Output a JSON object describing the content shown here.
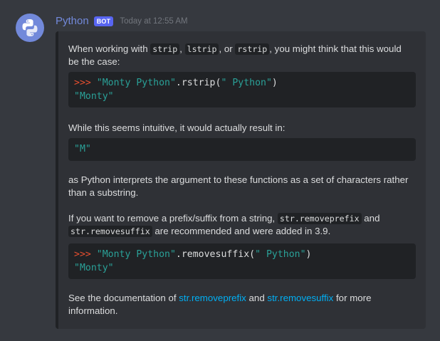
{
  "message": {
    "author": "Python",
    "badge": "BOT",
    "timestamp": "Today at 12:55 AM",
    "avatar_icon": "python-logo-icon"
  },
  "embed": {
    "p1": {
      "t1": "When working with ",
      "c1": "strip",
      "t2": ", ",
      "c2": "lstrip",
      "t3": ", or ",
      "c3": "rstrip",
      "t4": ", you might think that this would be the case:"
    },
    "code1": {
      "prompt": ">>> ",
      "str1": "\"Monty Python\"",
      "method": ".rstrip(",
      "str2": "\" Python\"",
      "close": ")",
      "result": "\"Monty\""
    },
    "p2": "While this seems intuitive, it would actually result in:",
    "code2": {
      "result": "\"M\""
    },
    "p3": "as Python interprets the argument to these functions as a set of characters rather than a substring.",
    "p4": {
      "t1": "If you want to remove a prefix/suffix from a string, ",
      "c1": "str.removeprefix",
      "t2": " and ",
      "c2": "str.removesuffix",
      "t3": " are recommended and were added in 3.9."
    },
    "code3": {
      "prompt": ">>> ",
      "str1": "\"Monty Python\"",
      "method": ".removesuffix(",
      "str2": "\" Python\"",
      "close": ")",
      "result": "\"Monty\""
    },
    "p5": {
      "t1": "See the documentation of ",
      "link1": "str.removeprefix",
      "t2": " and ",
      "link2": "str.removesuffix",
      "t3": " for more information."
    }
  },
  "colors": {
    "background": "#36393f",
    "embed_bg": "#2f3136",
    "code_bg": "#202225",
    "author": "#7289da",
    "badge": "#5865f2",
    "link": "#00aff4",
    "string": "#2aa198",
    "prompt": "#e84f2f"
  }
}
